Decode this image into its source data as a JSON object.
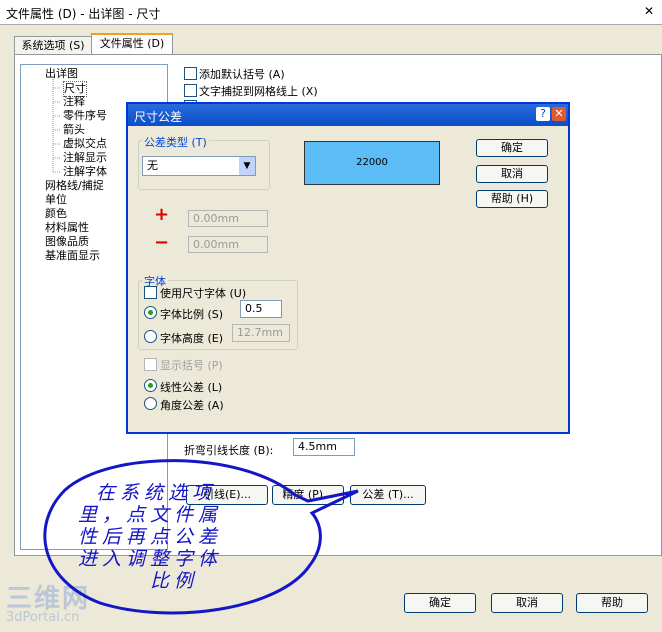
{
  "window": {
    "title": "文件属性 (D) - 出详图 - 尺寸"
  },
  "tabs": [
    {
      "label": "系统选项 (S)"
    },
    {
      "label": "文件属性 (D)"
    }
  ],
  "tree": {
    "items": [
      "出详图",
      "尺寸",
      "注释",
      "零件序号",
      "箭头",
      "虚拟交点",
      "注解显示",
      "注解字体",
      "网格线/捕捉",
      "单位",
      "颜色",
      "材料属性",
      "图像品质",
      "基准面显示"
    ]
  },
  "options": {
    "add_default_brackets": "添加默认括号 (A)",
    "snap_text_grid": "文字捕捉到网格线上 (X)",
    "bend_length_label": "折弯引线长度 (B):",
    "bend_length_value": "4.5mm",
    "arrows_button": "引线(E)...",
    "precision_button": "精度 (P)...",
    "tolerance_button": "公差 (T)..."
  },
  "dialog": {
    "title": "尺寸公差",
    "tolerance_type_label": "公差类型 (T)",
    "tolerance_type_value": "无",
    "preview_value": "22000",
    "ok": "确定",
    "cancel": "取消",
    "help": "帮助 (H)",
    "plus_sign": "+",
    "minus_sign": "−",
    "upper_value": "0.00mm",
    "lower_value": "0.00mm",
    "font_group": "字体",
    "use_dim_font": "使用尺寸字体 (U)",
    "font_scale": "字体比例 (S)",
    "font_scale_value": "0.5",
    "font_height": "字体高度 (E)",
    "font_height_value": "12.7mm",
    "show_brackets": "显示括号 (P)",
    "linear_tol": "线性公差 (L)",
    "angular_tol": "角度公差 (A)"
  },
  "annotation": {
    "lines": [
      "在系统选项",
      "里，点文件属",
      "性后再点公差",
      "进入调整字体",
      "比例"
    ]
  },
  "footer": {
    "ok": "确定",
    "cancel": "取消",
    "help": "帮助"
  },
  "watermark": {
    "brand": "三维网",
    "site": "3dPortal.cn"
  }
}
